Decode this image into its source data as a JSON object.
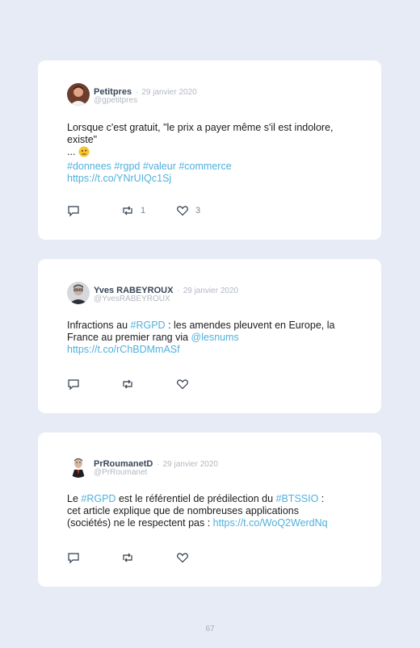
{
  "tweets": [
    {
      "name": "Petitpres",
      "sep": "·",
      "date": "29 janvier 2020",
      "handle": "@gpetitpres",
      "line1": "Lorsque c'est gratuit, \"le prix a payer même s'il est indolore,",
      "line2": "existe\"",
      "line3": "...",
      "emoji": "🙄",
      "tags": [
        "#donnees",
        "#rgpd",
        "#valeur",
        "#commerce"
      ],
      "url": "https://t.co/YNrUIQc1Sj",
      "retweets": "1",
      "likes": "3"
    },
    {
      "name": "Yves RABEYROUX",
      "sep": "·",
      "date": "29 janvier 2020",
      "handle": "@YvesRABEYROUX",
      "p1": "Infractions au ",
      "tag": "#RGPD",
      "p2": " : les amendes pleuvent en Europe, la",
      "p3": "France au premier rang via ",
      "mention": "@lesnums",
      "url": "https://t.co/rChBDMmASf"
    },
    {
      "name": "PrRoumanetD",
      "sep": "·",
      "date": "29 janvier 2020",
      "handle": "@PrRoumanet",
      "p1": "Le ",
      "tag1": "#RGPD",
      "p2": " est le référentiel de prédilection du ",
      "tag2": "#BTSSIO",
      "p3": " :",
      "p4": "cet article explique que de nombreuses applications",
      "p5": "(sociétés) ne le respectent pas : ",
      "url": "https://t.co/WoQ2WerdNq"
    }
  ],
  "page_number": "67",
  "colors": {
    "link": "#4fb0dc",
    "background": "#e7ebf5",
    "card": "#ffffff"
  }
}
